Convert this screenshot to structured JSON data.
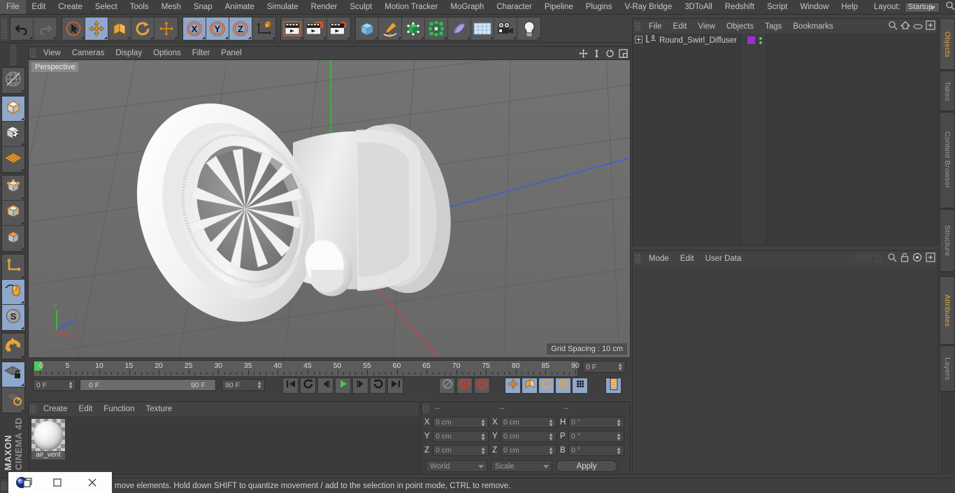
{
  "menubar": {
    "items": [
      "File",
      "Edit",
      "Create",
      "Select",
      "Tools",
      "Mesh",
      "Snap",
      "Animate",
      "Simulate",
      "Render",
      "Sculpt",
      "Motion Tracker",
      "MoGraph",
      "Character",
      "Pipeline",
      "Plugins",
      "V-Ray Bridge",
      "3DToAll",
      "Redshift",
      "Script",
      "Window",
      "Help"
    ],
    "layout_label": "Layout:",
    "layout_value": "Startup",
    "search_icon": "search-icon"
  },
  "toolbar": {
    "groups": [
      {
        "name": "history",
        "buttons": [
          {
            "icon": "undo-icon",
            "label": "Undo",
            "active": false
          },
          {
            "icon": "redo-icon",
            "label": "Redo",
            "active": false
          }
        ]
      },
      {
        "name": "transform",
        "buttons": [
          {
            "icon": "live-selection-icon",
            "label": "Live Selection",
            "active": false
          },
          {
            "icon": "move-icon",
            "label": "Move",
            "active": true
          },
          {
            "icon": "scale-icon",
            "label": "Scale",
            "active": false
          },
          {
            "icon": "rotate-icon",
            "label": "Rotate",
            "active": false
          },
          {
            "icon": "move-alt-icon",
            "label": "Move Tool Alt",
            "active": false
          }
        ]
      },
      {
        "name": "axis-lock",
        "buttons": [
          {
            "icon": "axis-x-icon",
            "label": "X Axis",
            "active": true
          },
          {
            "icon": "axis-y-icon",
            "label": "Y Axis",
            "active": true
          },
          {
            "icon": "axis-z-icon",
            "label": "Z Axis",
            "active": true
          },
          {
            "icon": "world-coordinate-icon",
            "label": "World / Object Coordinate System",
            "active": false
          }
        ]
      },
      {
        "name": "render",
        "buttons": [
          {
            "icon": "render-view-icon",
            "label": "Render View",
            "active": false
          },
          {
            "icon": "render-picture-viewer-icon",
            "label": "Render to Picture Viewer",
            "active": false
          },
          {
            "icon": "render-settings-icon",
            "label": "Edit Render Settings",
            "active": false
          }
        ]
      },
      {
        "name": "objects",
        "buttons": [
          {
            "icon": "cube-primitive-icon",
            "label": "Add Cube Object",
            "active": false
          },
          {
            "icon": "spline-pen-icon",
            "label": "Add Spline",
            "active": false
          },
          {
            "icon": "generator-icon",
            "label": "Add Generator",
            "active": false
          },
          {
            "icon": "mograph-icon",
            "label": "MoGraph Object",
            "active": false
          },
          {
            "icon": "deformer-icon",
            "label": "Add Deformer",
            "active": false
          },
          {
            "icon": "environment-icon",
            "label": "Add Scene Object",
            "active": false
          },
          {
            "icon": "camera-icon",
            "label": "Add Camera",
            "active": false
          },
          {
            "icon": "light-icon",
            "label": "Add Light",
            "active": false
          }
        ]
      }
    ]
  },
  "left_palette": {
    "groups": [
      {
        "buttons": [
          {
            "icon": "make-editable-icon",
            "label": "Make Editable",
            "active": false
          }
        ]
      },
      {
        "buttons": [
          {
            "icon": "model-mode-icon",
            "label": "Model Mode",
            "active": true
          },
          {
            "icon": "texture-mode-icon",
            "label": "Texture Mode",
            "active": false
          },
          {
            "icon": "workplane-mode-icon",
            "label": "Workplane Mode",
            "active": false
          }
        ]
      },
      {
        "buttons": [
          {
            "icon": "point-mode-icon",
            "label": "Points Mode",
            "active": false
          },
          {
            "icon": "edge-mode-icon",
            "label": "Edges Mode",
            "active": false
          },
          {
            "icon": "polygon-mode-icon",
            "label": "Polygons Mode",
            "active": false
          }
        ]
      },
      {
        "buttons": [
          {
            "icon": "object-axis-icon",
            "label": "Enable Axis Modification",
            "active": false
          },
          {
            "icon": "viewport-solo-icon",
            "label": "Viewport Solo",
            "active": true
          },
          {
            "icon": "soft-selection-icon",
            "label": "Enable Soft Selection",
            "active": true
          }
        ]
      },
      {
        "buttons": [
          {
            "icon": "snap-magnet-icon",
            "label": "Enable Snapping",
            "active": false
          }
        ]
      },
      {
        "buttons": [
          {
            "icon": "workplane-lock-icon",
            "label": "Lock Workplane",
            "active": true
          },
          {
            "icon": "planar-workplane-icon",
            "label": "Planar Workplane Mode",
            "active": false
          }
        ]
      }
    ],
    "brand_top": "MAXON",
    "brand_bottom": "CINEMA 4D"
  },
  "viewport": {
    "menu": [
      "View",
      "Cameras",
      "Display",
      "Options",
      "Filter",
      "Panel"
    ],
    "corner_icons": [
      "pan-icon",
      "dolly-icon",
      "rotate-view-icon",
      "maximize-view-icon"
    ],
    "label": "Perspective",
    "grid_spacing": "Grid Spacing : 10 cm",
    "axis": {
      "x": "X",
      "y": "Y",
      "z": "Z",
      "x_color": "#d24040",
      "y_color": "#3fb83f",
      "z_color": "#3b5fd9"
    },
    "scene_object": "Round_Swirl_Diffuser"
  },
  "timeline": {
    "ticks": [
      "0",
      "5",
      "10",
      "15",
      "20",
      "25",
      "30",
      "35",
      "40",
      "45",
      "50",
      "55",
      "60",
      "65",
      "70",
      "75",
      "80",
      "85",
      "90"
    ],
    "current_frame_field": "0 F",
    "start_field": "0 F",
    "slider_min": "0 F",
    "slider_max": "90 F",
    "end_field": "90 F",
    "transport": [
      {
        "icon": "go-to-start-icon",
        "label": "Go to Start"
      },
      {
        "icon": "previous-key-icon",
        "label": "Go to Previous Key"
      },
      {
        "icon": "step-back-icon",
        "label": "Go to Previous Frame"
      },
      {
        "icon": "play-icon",
        "label": "Play Forwards"
      },
      {
        "icon": "step-forward-icon",
        "label": "Go to Next Frame"
      },
      {
        "icon": "next-key-icon",
        "label": "Go to Next Key"
      },
      {
        "icon": "go-to-end-icon",
        "label": "Go to End"
      }
    ],
    "record_group": [
      {
        "icon": "autokey-icon",
        "label": "Autokeying",
        "active": false
      },
      {
        "icon": "record-active-objects-icon",
        "label": "Record Active Objects",
        "active": false
      },
      {
        "icon": "key-selection-icon",
        "label": "Keyframe Selection",
        "active": false
      }
    ],
    "key_toggles": [
      {
        "icon": "key-position-icon",
        "label": "Position",
        "active": true
      },
      {
        "icon": "key-scale-icon",
        "label": "Scale",
        "active": true
      },
      {
        "icon": "key-rotation-icon",
        "label": "Rotation",
        "active": true
      },
      {
        "icon": "key-parameter-icon",
        "label": "Parameter",
        "active": true
      },
      {
        "icon": "key-pla-icon",
        "label": "Point Level Animation",
        "active": true
      }
    ],
    "timeline_toggle": {
      "icon": "timeline-icon",
      "label": "Animation Mode",
      "active": true
    }
  },
  "material_manager": {
    "menu": [
      "Create",
      "Edit",
      "Function",
      "Texture"
    ],
    "materials": [
      {
        "name": "air_vent",
        "icon": "material-sphere-icon"
      }
    ]
  },
  "coordinates": {
    "headers": [
      "--",
      "--",
      "--"
    ],
    "rows": [
      {
        "pos_label": "X",
        "pos_value": "0 cm",
        "size_label": "X",
        "size_value": "0 cm",
        "rot_label": "H",
        "rot_value": "0 °"
      },
      {
        "pos_label": "Y",
        "pos_value": "0 cm",
        "size_label": "Y",
        "size_value": "0 cm",
        "rot_label": "P",
        "rot_value": "0 °"
      },
      {
        "pos_label": "Z",
        "pos_value": "0 cm",
        "size_label": "Z",
        "size_value": "0 cm",
        "rot_label": "B",
        "rot_value": "0 °"
      }
    ],
    "system": "World",
    "mode": "Scale",
    "apply": "Apply"
  },
  "object_manager": {
    "menu": [
      "File",
      "Edit",
      "View",
      "Objects",
      "Tags",
      "Bookmarks"
    ],
    "icons": [
      "search-icon",
      "home-icon",
      "ellipse-icon",
      "add-layer-icon"
    ],
    "objects": [
      {
        "name": "Round_Swirl_Diffuser",
        "expander": "+",
        "tag": "L0",
        "layer_color": "#9b2fd4",
        "visible_top": true,
        "visible_bottom": true
      }
    ]
  },
  "attribute_manager": {
    "menu": [
      "Mode",
      "Edit",
      "User Data"
    ],
    "icons": [
      "back-arrow-icon",
      "forward-arrow-icon",
      "search-icon",
      "lock-icon",
      "target-icon",
      "add-icon"
    ]
  },
  "right_tabs": {
    "top": [
      {
        "label": "Objects",
        "selected": true
      },
      {
        "label": "Takes",
        "selected": false
      },
      {
        "label": "Content Browser",
        "selected": false
      },
      {
        "label": "Structure",
        "selected": false
      }
    ],
    "bottom": [
      {
        "label": "Attributes",
        "selected": true
      },
      {
        "label": "Layers",
        "selected": false
      }
    ]
  },
  "statusbar": {
    "message": "move elements. Hold down SHIFT to quantize movement / add to the selection in point mode, CTRL to remove."
  },
  "window_overlay": {
    "app_icon": "cinema4d-icon",
    "restore_icon": "restore-window-icon",
    "maximize_icon": "maximize-window-icon",
    "close_icon": "close-window-icon"
  },
  "colors": {
    "accent_orange": "#e8a33d",
    "active_blue": "#8ea7cb",
    "panel_bg": "#3b3b3b",
    "viewport_bg": "#6e6e6e"
  }
}
